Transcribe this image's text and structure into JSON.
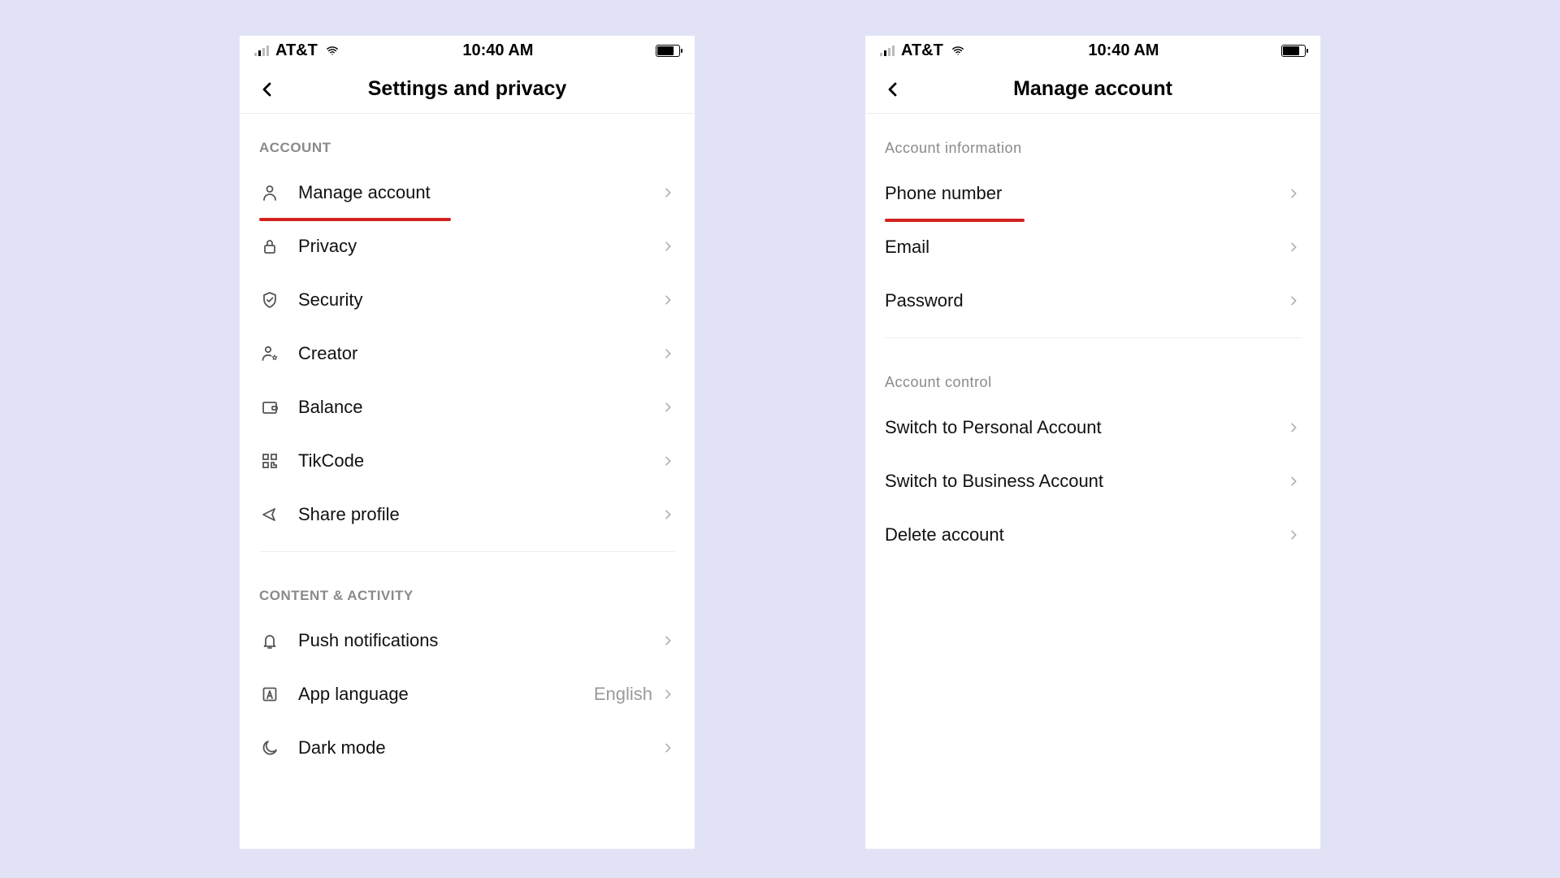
{
  "status": {
    "carrier": "AT&T",
    "time": "10:40 AM"
  },
  "screen1": {
    "title": "Settings and privacy",
    "section_account": "ACCOUNT",
    "section_content": "CONTENT & ACTIVITY",
    "items": {
      "manage_account": "Manage account",
      "privacy": "Privacy",
      "security": "Security",
      "creator": "Creator",
      "balance": "Balance",
      "tikcode": "TikCode",
      "share_profile": "Share profile",
      "push": "Push notifications",
      "language": "App language",
      "language_value": "English",
      "dark_mode": "Dark mode"
    }
  },
  "screen2": {
    "title": "Manage account",
    "section_info": "Account information",
    "section_control": "Account control",
    "items": {
      "phone": "Phone number",
      "email": "Email",
      "password": "Password",
      "switch_personal": "Switch to Personal Account",
      "switch_business": "Switch to Business Account",
      "delete": "Delete account"
    }
  }
}
